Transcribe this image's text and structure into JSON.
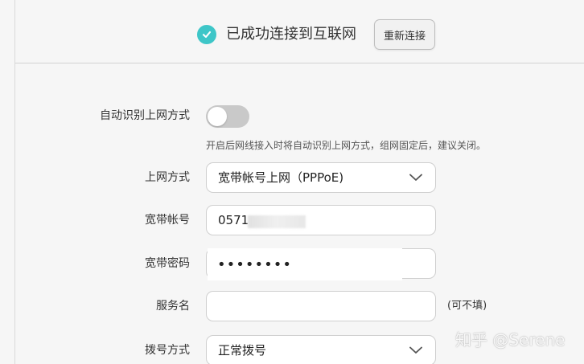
{
  "status": {
    "text": "已成功连接到互联网",
    "reconnect_label": "重新连接",
    "accent_color": "#3ec6c8",
    "icon": "check-circle-icon"
  },
  "form": {
    "auto_detect": {
      "label": "自动识别上网方式",
      "enabled": false,
      "hint": "开启后网线接入时将自动识别上网方式，组网固定后，建议关闭。"
    },
    "connection_type": {
      "label": "上网方式",
      "value": "宽带帐号上网（PPPoE)",
      "icon": "chevron-down-icon"
    },
    "account": {
      "label": "宽带帐号",
      "value": "0571"
    },
    "password": {
      "label": "宽带密码",
      "value": "••••••••"
    },
    "service_name": {
      "label": "服务名",
      "value": "",
      "note": "(可不填)"
    },
    "dial_mode": {
      "label": "拨号方式",
      "value": "正常拨号",
      "icon": "chevron-down-icon"
    }
  },
  "watermark": {
    "text": "知乎 @Serene"
  }
}
